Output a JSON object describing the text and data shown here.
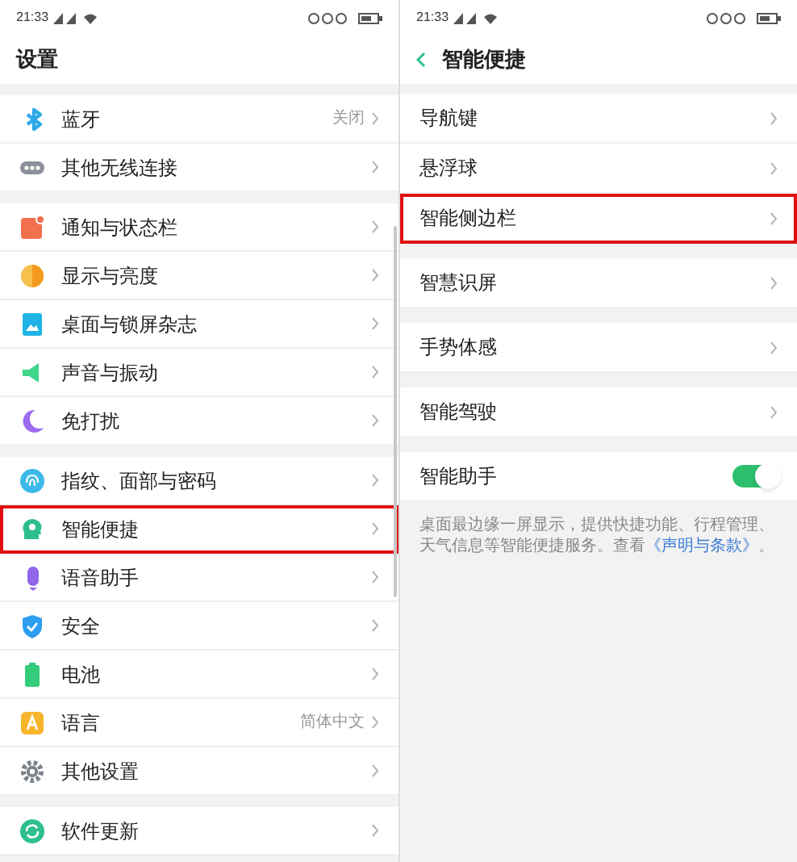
{
  "left": {
    "status_bar": {
      "time": "21:33"
    },
    "title": "设置",
    "groups": [
      {
        "items": [
          {
            "kind": "bluetooth",
            "label": "蓝牙",
            "value": "关闭",
            "highlighted": false
          },
          {
            "kind": "wireless",
            "label": "其他无线连接",
            "highlighted": false
          }
        ]
      },
      {
        "items": [
          {
            "kind": "notification",
            "label": "通知与状态栏",
            "highlighted": false
          },
          {
            "kind": "display",
            "label": "显示与亮度",
            "highlighted": false
          },
          {
            "kind": "wallpaper",
            "label": "桌面与锁屏杂志",
            "highlighted": false
          },
          {
            "kind": "sound",
            "label": "声音与振动",
            "highlighted": false
          },
          {
            "kind": "moon",
            "label": "免打扰",
            "highlighted": false
          }
        ]
      },
      {
        "items": [
          {
            "kind": "fingerprint",
            "label": "指纹、面部与密码",
            "highlighted": false
          },
          {
            "kind": "smart",
            "label": "智能便捷",
            "highlighted": true
          },
          {
            "kind": "voice",
            "label": "语音助手",
            "highlighted": false
          },
          {
            "kind": "shield",
            "label": "安全",
            "highlighted": false
          },
          {
            "kind": "battery",
            "label": "电池",
            "highlighted": false
          },
          {
            "kind": "language",
            "label": "语言",
            "value": "简体中文",
            "highlighted": false
          },
          {
            "kind": "gear",
            "label": "其他设置",
            "highlighted": false
          }
        ]
      },
      {
        "items": [
          {
            "kind": "update",
            "label": "软件更新",
            "highlighted": false
          }
        ]
      }
    ]
  },
  "right": {
    "status_bar": {
      "time": "21:33"
    },
    "title": "智能便捷",
    "groups": [
      {
        "items": [
          {
            "kind": "link",
            "label": "导航键",
            "highlighted": false
          },
          {
            "kind": "link",
            "label": "悬浮球",
            "highlighted": false
          },
          {
            "kind": "link",
            "label": "智能侧边栏",
            "highlighted": true
          }
        ]
      },
      {
        "items": [
          {
            "kind": "link",
            "label": "智慧识屏",
            "highlighted": false
          }
        ]
      },
      {
        "items": [
          {
            "kind": "link",
            "label": "手势体感",
            "highlighted": false
          }
        ]
      },
      {
        "items": [
          {
            "kind": "link",
            "label": "智能驾驶",
            "highlighted": false
          }
        ]
      },
      {
        "items": [
          {
            "kind": "toggle",
            "label": "智能助手",
            "on": true,
            "highlighted": false
          }
        ]
      }
    ],
    "note": {
      "text": "桌面最边缘一屏显示，提供快捷功能、行程管理、天气信息等智能便捷服务。查看",
      "link": "《声明与条款》",
      "suffix": "。"
    }
  }
}
